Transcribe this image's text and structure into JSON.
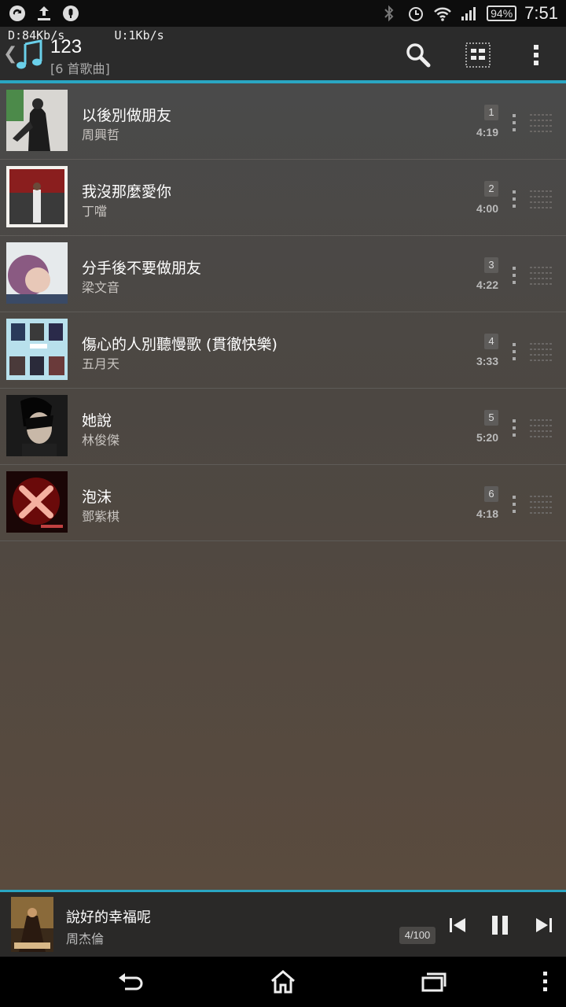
{
  "status_bar": {
    "time": "7:51",
    "battery": "94%",
    "left_icons": [
      "sync-icon",
      "upload-icon",
      "microphone-icon"
    ],
    "right_icons": [
      "bluetooth-icon",
      "alarm-icon",
      "wifi-icon",
      "signal-icon",
      "battery-icon"
    ]
  },
  "header": {
    "net_speed": "D:84Kb/s       U:1Kb/s",
    "title": "123",
    "subtitle": "[6 首歌曲]",
    "icons": [
      "back-chevron-icon",
      "music-note-icon",
      "search-icon",
      "view-mode-icon",
      "overflow-menu-icon"
    ]
  },
  "songs": [
    {
      "title": "以後別做朋友",
      "artist": "周興哲",
      "index": "1",
      "duration": "4:19"
    },
    {
      "title": "我沒那麼愛你",
      "artist": "丁噹",
      "index": "2",
      "duration": "4:00"
    },
    {
      "title": "分手後不要做朋友",
      "artist": "梁文音",
      "index": "3",
      "duration": "4:22"
    },
    {
      "title": "傷心的人別聽慢歌 (貫徹快樂)",
      "artist": "五月天",
      "index": "4",
      "duration": "3:33"
    },
    {
      "title": "她說",
      "artist": "林俊傑",
      "index": "5",
      "duration": "5:20"
    },
    {
      "title": "泡沫",
      "artist": "鄧紫棋",
      "index": "6",
      "duration": "4:18"
    }
  ],
  "now_playing": {
    "title": "說好的幸福呢",
    "artist": "周杰倫",
    "queue_position": "4/100",
    "controls": [
      "previous-icon",
      "pause-icon",
      "next-icon"
    ]
  },
  "nav_bar": {
    "icons": [
      "back-icon",
      "home-icon",
      "recents-icon",
      "menu-icon"
    ]
  },
  "colors": {
    "accent": "#2aa6c3",
    "header_bg": "#2b2b2b",
    "player_bg": "#2a2928"
  }
}
